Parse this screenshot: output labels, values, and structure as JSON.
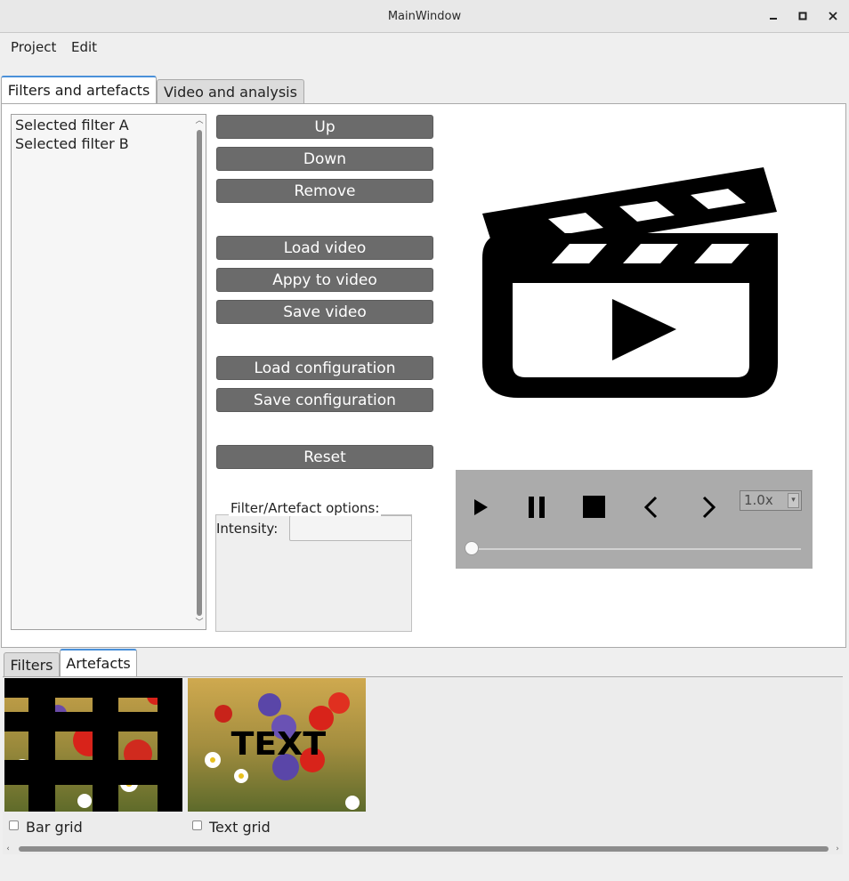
{
  "window": {
    "title": "MainWindow",
    "minimize": "‒",
    "maximize": "▫",
    "close": "✕"
  },
  "menu": {
    "project": "Project",
    "edit": "Edit"
  },
  "top_tabs": [
    {
      "label": "Filters and artefacts",
      "active": true
    },
    {
      "label": "Video and analysis",
      "active": false
    }
  ],
  "filter_list": {
    "items": [
      "Selected filter A",
      "Selected filter B"
    ]
  },
  "buttons": {
    "up": "Up",
    "down": "Down",
    "remove": "Remove",
    "load_video": "Load video",
    "apply_video": "Appy to video",
    "save_video": "Save video",
    "load_config": "Load configuration",
    "save_config": "Save configuration",
    "reset": "Reset"
  },
  "options": {
    "title": "Filter/Artefact options:",
    "intensity_label": "Intensity:",
    "intensity_value": ""
  },
  "player": {
    "speed": "1.0x",
    "position": 0
  },
  "bottom_tabs": [
    {
      "label": "Filters",
      "active": false
    },
    {
      "label": "Artefacts",
      "active": true
    }
  ],
  "artefacts": [
    {
      "label": "Bar grid",
      "checked": false,
      "overlay_text": ""
    },
    {
      "label": "Text grid",
      "checked": false,
      "overlay_text": "TEXT"
    }
  ],
  "colors": {
    "button_bg": "#6b6b6b",
    "controls_bg": "#ababab",
    "tab_accent": "#4a90d9"
  }
}
